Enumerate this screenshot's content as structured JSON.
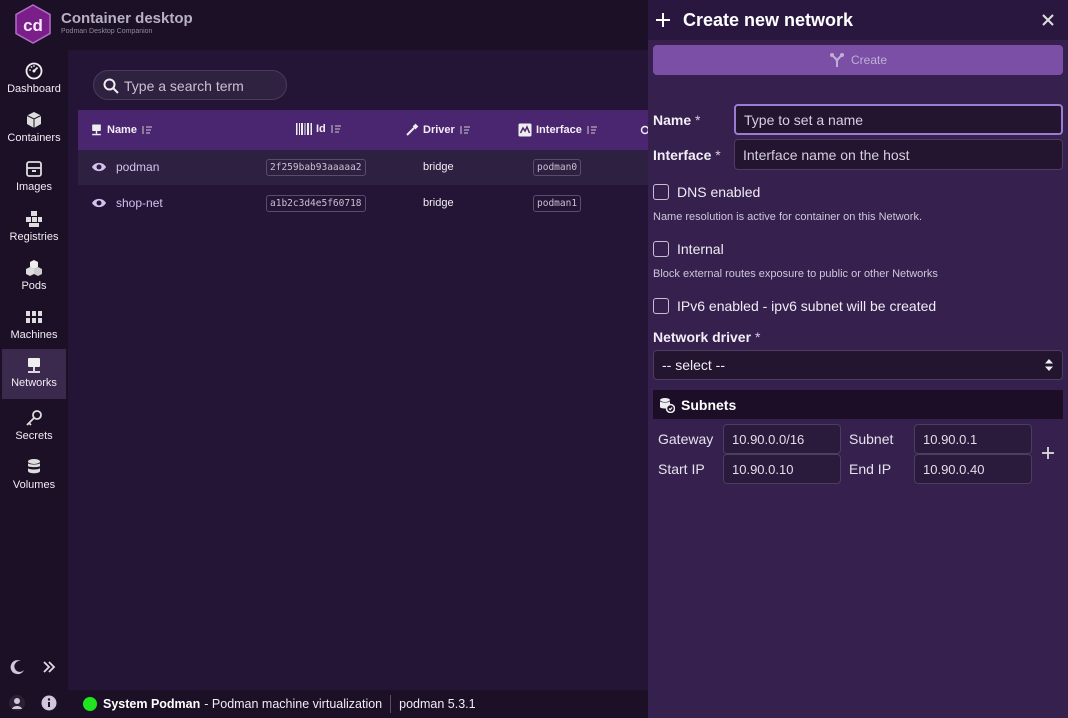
{
  "brand": {
    "logo_text": "cd",
    "title": "Container desktop",
    "subtitle": "Podman Desktop Companion"
  },
  "sidebar": {
    "items": [
      {
        "label": "Dashboard",
        "icon": "gauge-icon"
      },
      {
        "label": "Containers",
        "icon": "cube-icon"
      },
      {
        "label": "Images",
        "icon": "box-icon"
      },
      {
        "label": "Registries",
        "icon": "grid-icon"
      },
      {
        "label": "Pods",
        "icon": "cubes-icon"
      },
      {
        "label": "Machines",
        "icon": "server-grid-icon"
      },
      {
        "label": "Networks",
        "icon": "network-icon",
        "active": true
      },
      {
        "label": "Secrets",
        "icon": "key-icon"
      },
      {
        "label": "Volumes",
        "icon": "database-icon"
      }
    ]
  },
  "search": {
    "placeholder": "Type a search term"
  },
  "table": {
    "columns": [
      "Name",
      "Id",
      "Driver",
      "Interface"
    ],
    "rows": [
      {
        "name": "podman",
        "id": "2f259bab93aaaaa2",
        "driver": "bridge",
        "interface": "podman0"
      },
      {
        "name": "shop-net",
        "id": "a1b2c3d4e5f60718",
        "driver": "bridge",
        "interface": "podman1"
      }
    ]
  },
  "status": {
    "engine": "System Podman",
    "description": "- Podman machine virtualization",
    "version": "podman 5.3.1",
    "color": "#1ee51e"
  },
  "panel": {
    "title": "Create new network",
    "create_label": "Create",
    "name_label": "Name",
    "name_placeholder": "Type to set a name",
    "interface_label": "Interface",
    "interface_placeholder": "Interface name on the host",
    "required_mark": "*",
    "dns_label": "DNS enabled",
    "dns_help": "Name resolution is active for container on this Network.",
    "internal_label": "Internal",
    "internal_help": "Block external routes exposure to public or other Networks",
    "ipv6_label": "IPv6 enabled - ipv6 subnet will be created",
    "driver_label": "Network driver",
    "driver_value": "-- select --",
    "subnets_title": "Subnets",
    "gateway_label": "Gateway",
    "gateway_value": "10.90.0.0/16",
    "subnet_label": "Subnet",
    "subnet_value": "10.90.0.1",
    "start_label": "Start IP",
    "start_value": "10.90.0.10",
    "end_label": "End IP",
    "end_value": "10.90.0.40"
  }
}
